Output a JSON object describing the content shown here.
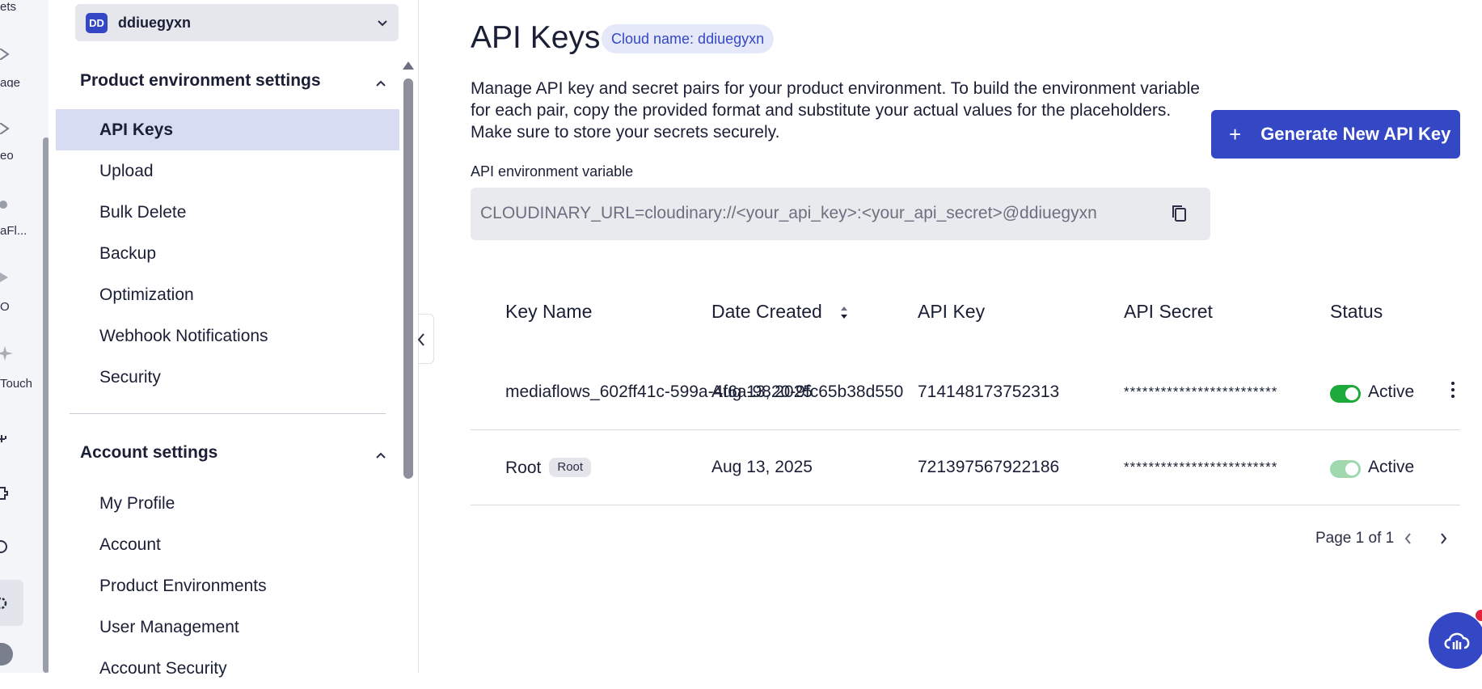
{
  "rail": {
    "items": [
      {
        "label": "ets",
        "icon": "assets-icon"
      },
      {
        "label": "age",
        "icon": "image-icon"
      },
      {
        "label": "eo",
        "icon": "video-icon"
      },
      {
        "label": "aFl...",
        "icon": "mediaflows-icon"
      },
      {
        "label": "O",
        "icon": "diamond-icon"
      },
      {
        "label": "Touch",
        "icon": "sparkle-icon"
      }
    ]
  },
  "sidebar": {
    "env_select": {
      "avatar": "DD",
      "name": "ddiuegyxn"
    },
    "product_section": {
      "title": "Product environment settings",
      "items": [
        {
          "label": "API Keys",
          "active": true
        },
        {
          "label": "Upload"
        },
        {
          "label": "Bulk Delete"
        },
        {
          "label": "Backup"
        },
        {
          "label": "Optimization"
        },
        {
          "label": "Webhook Notifications"
        },
        {
          "label": "Security"
        }
      ]
    },
    "account_section": {
      "title": "Account settings",
      "items": [
        {
          "label": "My Profile"
        },
        {
          "label": "Account"
        },
        {
          "label": "Product Environments"
        },
        {
          "label": "User Management"
        },
        {
          "label": "Account Security"
        }
      ]
    }
  },
  "main": {
    "title": "API Keys",
    "cloud_badge": "Cloud name: ddiuegyxn",
    "description": "Manage API key and secret pairs for your product environment. To build the environment variable for each pair, copy the provided format and substitute your actual values for the placeholders. Make sure to store your secrets securely.",
    "generate_button": "Generate New API Key",
    "env_var_label": "API environment variable",
    "env_var_value": "CLOUDINARY_URL=cloudinary://<your_api_key>:<your_api_secret>@ddiuegyxn",
    "table": {
      "headers": [
        "Key Name",
        "Date Created",
        "API Key",
        "API Secret",
        "Status"
      ],
      "rows": [
        {
          "name": "mediaflows_602ff41c-599a-4f6a-9820-9fc65b38d550",
          "tag": "",
          "date": "Aug 13, 2025",
          "key": "714148173752313",
          "secret": "*************************",
          "status": "Active",
          "toggle": "on"
        },
        {
          "name": "Root",
          "tag": "Root",
          "date": "Aug 13, 2025",
          "key": "721397567922186",
          "secret": "*************************",
          "status": "Active",
          "toggle": "dim"
        }
      ]
    },
    "pager": "Page 1 of 1"
  },
  "colors": {
    "accent": "#3448c5",
    "active_green": "#1eaa3b",
    "active_nav_bg": "#d8dcf3"
  }
}
